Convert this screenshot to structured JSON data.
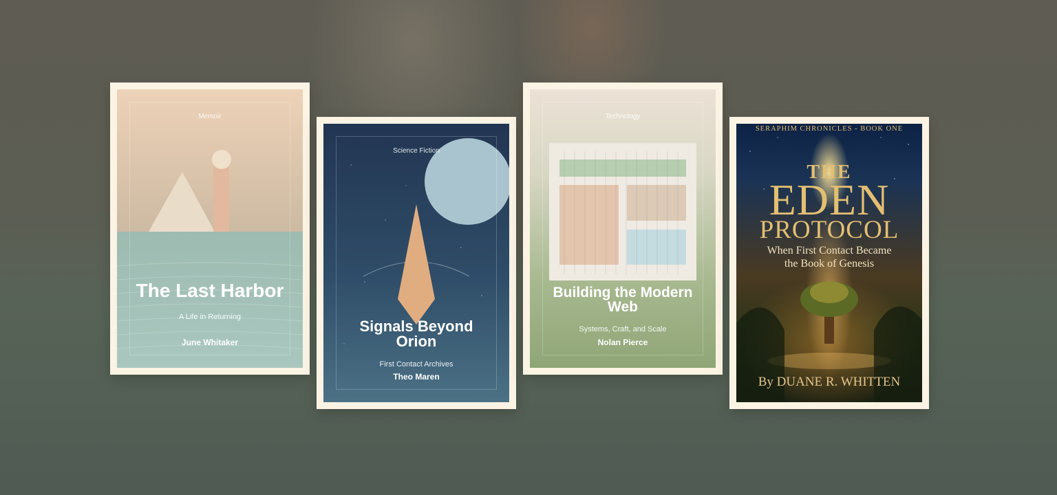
{
  "books": [
    {
      "genre": "Memoir",
      "title": "The Last Harbor",
      "subtitle": "A Life in Returning",
      "author": "June Whitaker"
    },
    {
      "genre": "Science Fiction",
      "title": "Signals Beyond Orion",
      "subtitle": "First Contact Archives",
      "author": "Theo Maren"
    },
    {
      "genre": "Technology",
      "title": "Building the Modern Web",
      "subtitle": "Systems, Craft, and Scale",
      "author": "Nolan Pierce"
    },
    {
      "series": "SERAPHIM CHRONICLES - BOOK ONE",
      "title_line1": "THE",
      "title_line2": "EDEN",
      "title_line3": "PROTOCOL",
      "subtitle_line1": "When First Contact Became",
      "subtitle_line2": "the Book of Genesis",
      "author": "By DUANE R. WHITTEN"
    }
  ],
  "colors": {
    "card_frame": "#fbf3e4",
    "gold_text": "#e3bf72",
    "peach_shape": "#e0ad80"
  }
}
